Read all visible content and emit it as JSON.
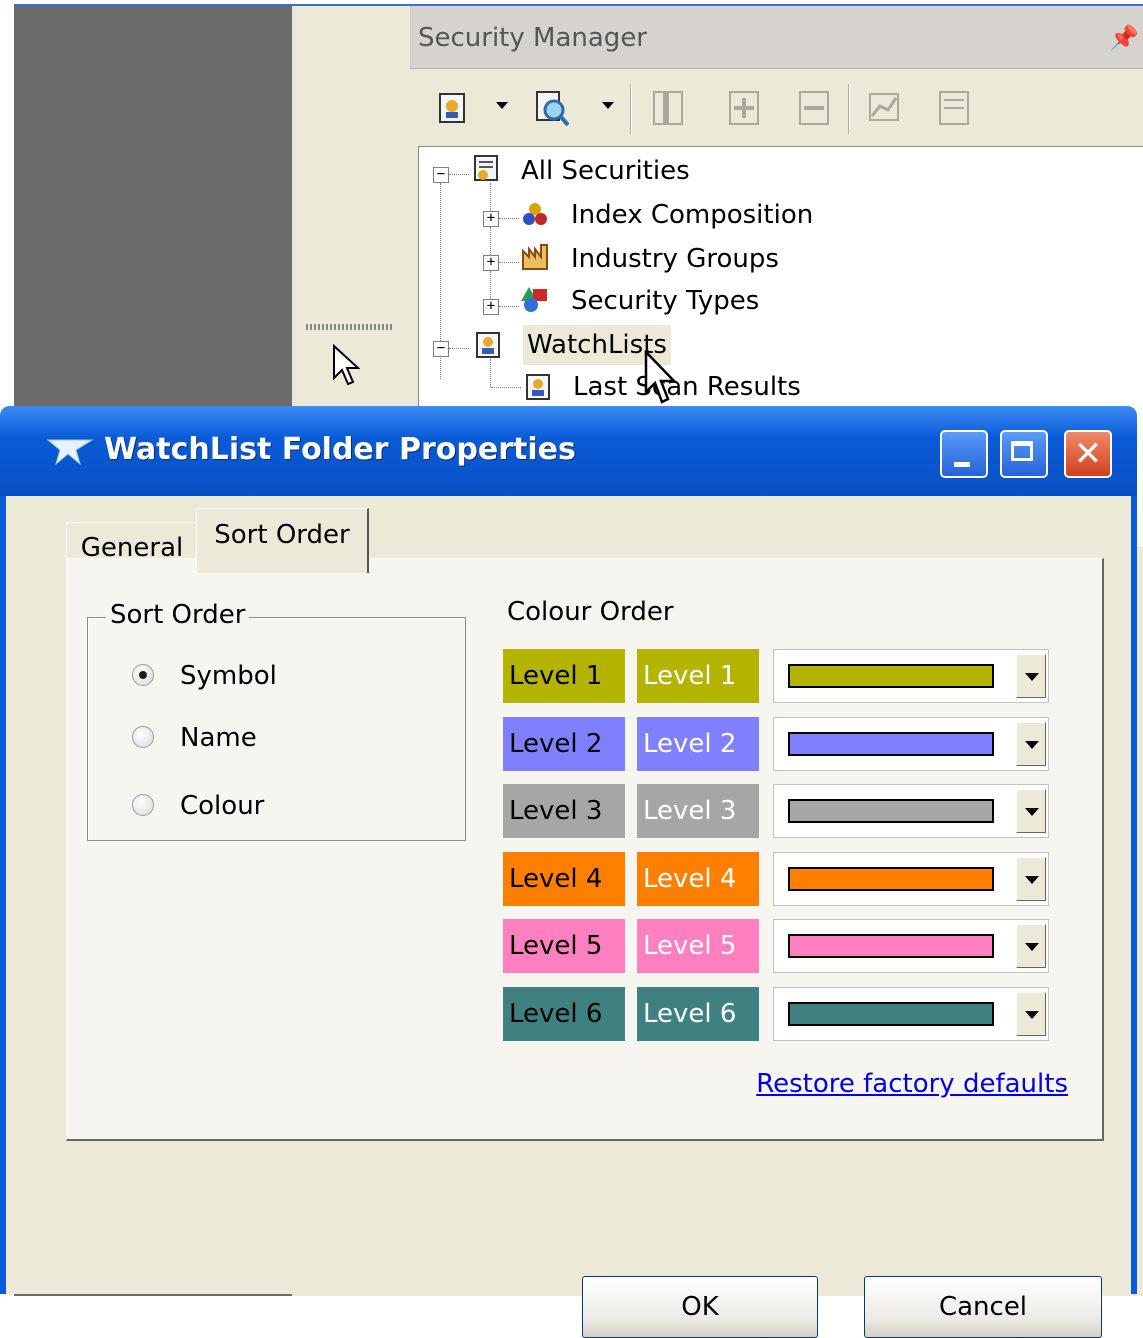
{
  "security_manager": {
    "title": "Security Manager",
    "toolbar_icons": [
      "security-icon",
      "search-security-icon",
      "column-icon",
      "add-column-icon",
      "remove-column-icon",
      "chart-icon",
      "report-icon"
    ],
    "tree": {
      "root": "All Securities",
      "children": [
        "Index Composition",
        "Industry Groups",
        "Security Types"
      ],
      "watchlists": "WatchLists",
      "watchlist_children": [
        "Last Scan Results"
      ]
    }
  },
  "dialog": {
    "title": "WatchList Folder Properties",
    "tabs": [
      "General",
      "Sort Order"
    ],
    "active_tab": "Sort Order",
    "sort_order": {
      "legend": "Sort Order",
      "options": [
        "Symbol",
        "Name",
        "Colour"
      ],
      "selected": "Symbol"
    },
    "colour_order": {
      "heading": "Colour Order",
      "levels": [
        {
          "label": "Level 1",
          "color": "#b3b300"
        },
        {
          "label": "Level 2",
          "color": "#8080ff"
        },
        {
          "label": "Level 3",
          "color": "#a6a6a6"
        },
        {
          "label": "Level 4",
          "color": "#ff8000"
        },
        {
          "label": "Level 5",
          "color": "#ff80c0"
        },
        {
          "label": "Level 6",
          "color": "#3f8080"
        }
      ]
    },
    "restore_link": "Restore factory defaults",
    "ok_label": "OK",
    "cancel_label": "Cancel"
  }
}
